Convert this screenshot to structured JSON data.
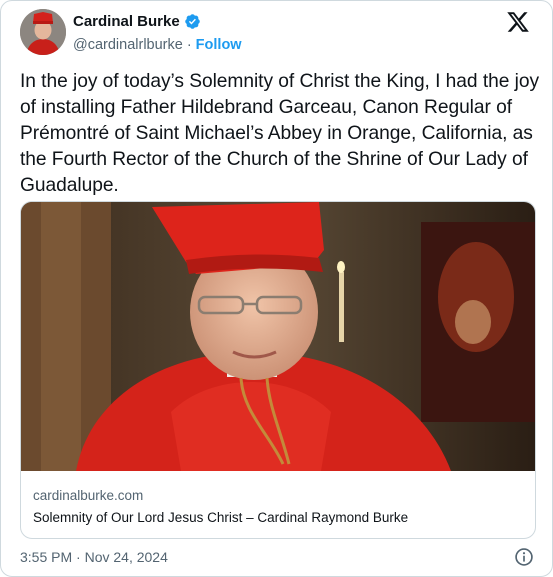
{
  "author": {
    "name": "Cardinal Burke",
    "handle": "@cardinalrlburke",
    "separator": "·",
    "follow_label": "Follow",
    "avatar_icon": "cardinal-portrait-avatar",
    "verified_icon": "verified-badge-icon",
    "verified_color": "#1d9bf0"
  },
  "header": {
    "logo_icon": "x-logo-icon"
  },
  "tweet": {
    "text": "In the joy of today’s Solemnity of Christ the King, I had the joy of installing Father Hildebrand Garceau, Canon Regular of Prémontré of Saint Michael’s Abbey in Orange, California, as the Fourth Rector of the Church of the Shrine of Our Lady of Guadalupe."
  },
  "link_card": {
    "image_icon": "cardinal-portrait-photo",
    "domain": "cardinalburke.com",
    "title": "Solemnity of Our Lord Jesus Christ – Cardinal Raymond Burke"
  },
  "footer": {
    "timestamp": "3:55 PM · Nov 24, 2024",
    "info_icon": "info-icon"
  },
  "colors": {
    "text": "#0f1419",
    "secondary": "#536471",
    "accent": "#1d9bf0",
    "border": "#cfd9de"
  }
}
